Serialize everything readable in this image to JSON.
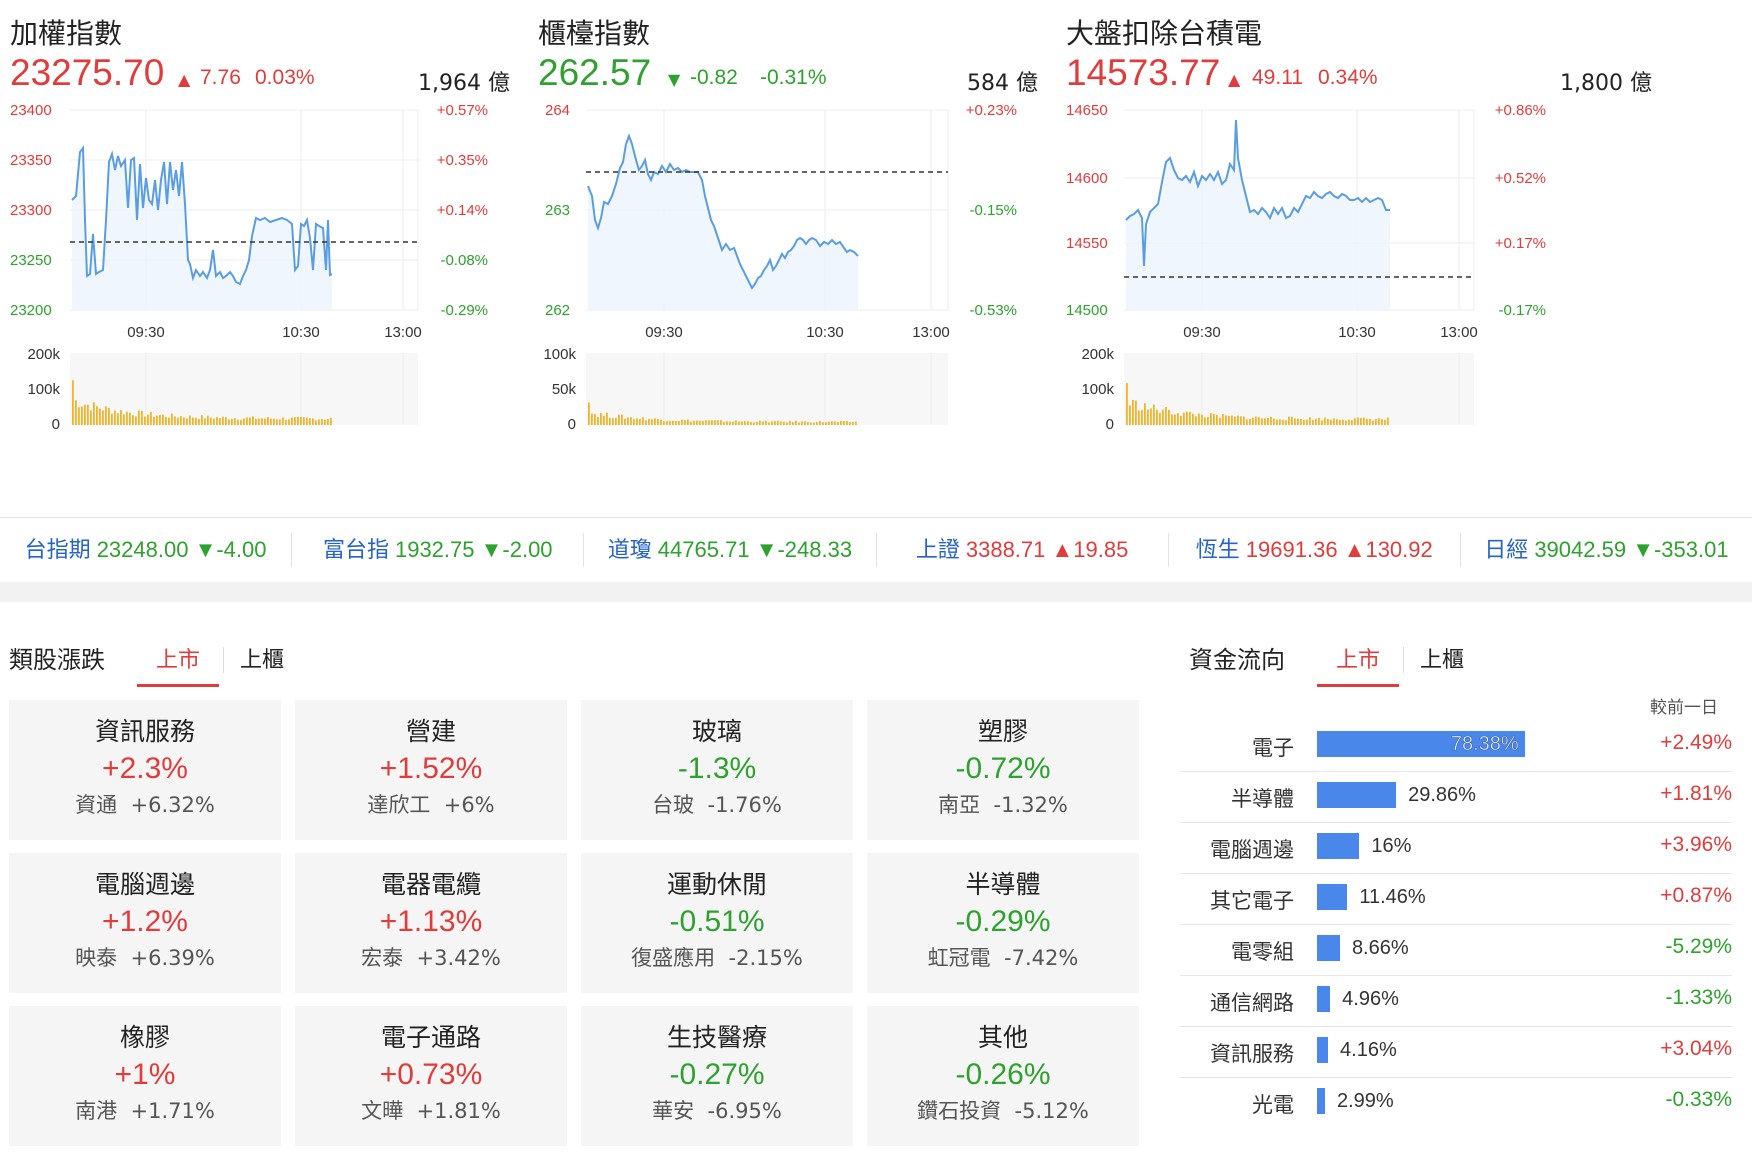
{
  "indices": [
    {
      "title": "加權指數",
      "value": "23275.70",
      "direction": "up",
      "change": "7.76",
      "pct": "0.03%",
      "amount": "1,964 億",
      "price_ticks": [
        "23400",
        "23350",
        "23300",
        "23250",
        "23200"
      ],
      "pct_ticks": [
        "+0.57%",
        "+0.35%",
        "+0.14%",
        "-0.08%",
        "-0.29%"
      ],
      "pct_tick_dirs": [
        "up",
        "up",
        "up",
        "down",
        "down"
      ],
      "time_ticks": [
        "09:30",
        "10:30",
        "13:00"
      ],
      "vol_ticks": [
        "200k",
        "100k",
        "0"
      ]
    },
    {
      "title": "櫃檯指數",
      "value": "262.57",
      "direction": "down",
      "change": "-0.82",
      "pct": "-0.31%",
      "amount": "584 億",
      "price_ticks": [
        "264",
        "263",
        "262"
      ],
      "pct_ticks": [
        "+0.23%",
        "-0.15%",
        "-0.53%"
      ],
      "pct_tick_dirs": [
        "up",
        "down",
        "down"
      ],
      "time_ticks": [
        "09:30",
        "10:30",
        "13:00"
      ],
      "vol_ticks": [
        "100k",
        "50k",
        "0"
      ]
    },
    {
      "title": "大盤扣除台積電",
      "value": "14573.77",
      "direction": "up",
      "change": "49.11",
      "pct": "0.34%",
      "amount": "1,800 億",
      "price_ticks": [
        "14650",
        "14600",
        "14550",
        "14500"
      ],
      "pct_ticks": [
        "+0.86%",
        "+0.52%",
        "+0.17%",
        "-0.17%"
      ],
      "pct_tick_dirs": [
        "up",
        "up",
        "up",
        "down"
      ],
      "time_ticks": [
        "09:30",
        "10:30",
        "13:00"
      ],
      "vol_ticks": [
        "200k",
        "100k",
        "0"
      ]
    }
  ],
  "ticker": [
    {
      "name": "台指期",
      "value": "23248.00",
      "change": "▼-4.00",
      "dir": "down"
    },
    {
      "name": "富台指",
      "value": "1932.75",
      "change": "▼-2.00",
      "dir": "down"
    },
    {
      "name": "道瓊",
      "value": "44765.71",
      "change": "▼-248.33",
      "dir": "down"
    },
    {
      "name": "上證",
      "value": "3388.71",
      "change": "▲19.85",
      "dir": "up"
    },
    {
      "name": "恆生",
      "value": "19691.36",
      "change": "▲130.92",
      "dir": "up"
    },
    {
      "name": "日經",
      "value": "39042.59",
      "change": "▼-353.01",
      "dir": "down"
    }
  ],
  "sectors": {
    "heading": "類股漲跌",
    "tabs": [
      "上市",
      "上櫃"
    ],
    "cards": [
      {
        "name": "資訊服務",
        "pct": "+2.3%",
        "dir": "up",
        "stock": "資通",
        "stock_pct": "+6.32%"
      },
      {
        "name": "營建",
        "pct": "+1.52%",
        "dir": "up",
        "stock": "達欣工",
        "stock_pct": "+6%"
      },
      {
        "name": "玻璃",
        "pct": "-1.3%",
        "dir": "down",
        "stock": "台玻",
        "stock_pct": "-1.76%"
      },
      {
        "name": "塑膠",
        "pct": "-0.72%",
        "dir": "down",
        "stock": "南亞",
        "stock_pct": "-1.32%"
      },
      {
        "name": "電腦週邊",
        "pct": "+1.2%",
        "dir": "up",
        "stock": "映泰",
        "stock_pct": "+6.39%"
      },
      {
        "name": "電器電纜",
        "pct": "+1.13%",
        "dir": "up",
        "stock": "宏泰",
        "stock_pct": "+3.42%"
      },
      {
        "name": "運動休閒",
        "pct": "-0.51%",
        "dir": "down",
        "stock": "復盛應用",
        "stock_pct": "-2.15%"
      },
      {
        "name": "半導體",
        "pct": "-0.29%",
        "dir": "down",
        "stock": "虹冠電",
        "stock_pct": "-7.42%"
      },
      {
        "name": "橡膠",
        "pct": "+1%",
        "dir": "up",
        "stock": "南港",
        "stock_pct": "+1.71%"
      },
      {
        "name": "電子通路",
        "pct": "+0.73%",
        "dir": "up",
        "stock": "文曄",
        "stock_pct": "+1.81%"
      },
      {
        "name": "生技醫療",
        "pct": "-0.27%",
        "dir": "down",
        "stock": "華安",
        "stock_pct": "-6.95%"
      },
      {
        "name": "其他",
        "pct": "-0.26%",
        "dir": "down",
        "stock": "鑽石投資",
        "stock_pct": "-5.12%"
      }
    ]
  },
  "fund_flow": {
    "heading": "資金流向",
    "tabs": [
      "上市",
      "上櫃"
    ],
    "note": "較前一日",
    "rows": [
      {
        "name": "電子",
        "share": 78.38,
        "share_label": "78.38%",
        "change": "+2.49%",
        "dir": "up"
      },
      {
        "name": "半導體",
        "share": 29.86,
        "share_label": "29.86%",
        "change": "+1.81%",
        "dir": "up"
      },
      {
        "name": "電腦週邊",
        "share": 16,
        "share_label": "16%",
        "change": "+3.96%",
        "dir": "up"
      },
      {
        "name": "其它電子",
        "share": 11.46,
        "share_label": "11.46%",
        "change": "+0.87%",
        "dir": "up"
      },
      {
        "name": "電零組",
        "share": 8.66,
        "share_label": "8.66%",
        "change": "-5.29%",
        "dir": "down"
      },
      {
        "name": "通信網路",
        "share": 4.96,
        "share_label": "4.96%",
        "change": "-1.33%",
        "dir": "down"
      },
      {
        "name": "資訊服務",
        "share": 4.16,
        "share_label": "4.16%",
        "change": "+3.04%",
        "dir": "up"
      },
      {
        "name": "光電",
        "share": 2.99,
        "share_label": "2.99%",
        "change": "-0.33%",
        "dir": "down"
      }
    ]
  },
  "colors": {
    "up": "#e03c3c",
    "down": "#2ea12e",
    "line": "#5a9de0",
    "volume": "#f0b429",
    "link": "#2563c9",
    "bar": "#4a87ea"
  }
}
